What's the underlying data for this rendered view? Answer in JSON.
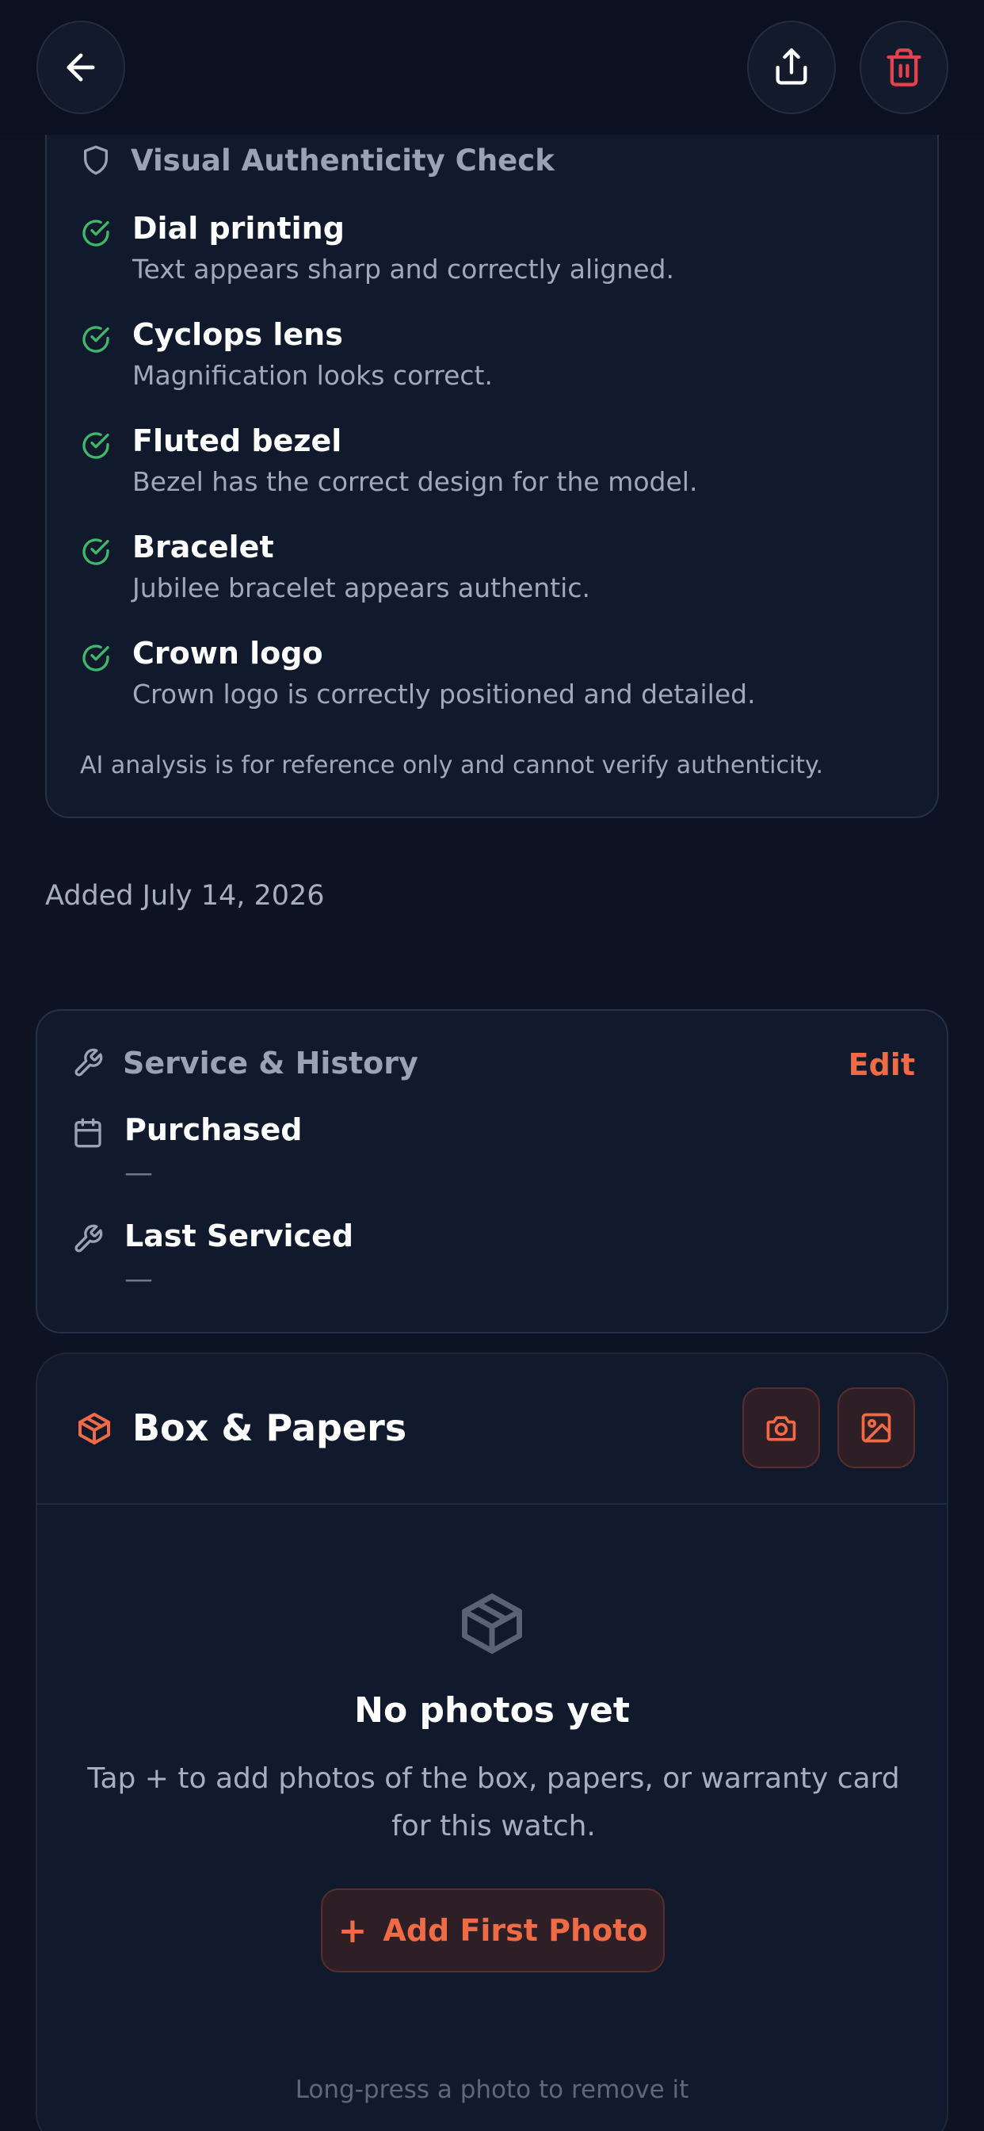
{
  "colors": {
    "background": "#0d1322",
    "card": "#111a2c",
    "accent": "#ef6a45",
    "success": "#3fb86a",
    "danger": "#e0424e",
    "muted_text": "#a0a9ba"
  },
  "topbar": {
    "back_icon": "arrow-left-icon",
    "share_icon": "share-icon",
    "delete_icon": "trash-icon"
  },
  "authenticity": {
    "title": "Visual Authenticity Check",
    "icon": "shield-icon",
    "items": [
      {
        "title": "Dial printing",
        "description": "Text appears sharp and correctly aligned.",
        "status": "pass"
      },
      {
        "title": "Cyclops lens",
        "description": "Magnification looks correct.",
        "status": "pass"
      },
      {
        "title": "Fluted bezel",
        "description": "Bezel has the correct design for the model.",
        "status": "pass"
      },
      {
        "title": "Bracelet",
        "description": "Jubilee bracelet appears authentic.",
        "status": "pass"
      },
      {
        "title": "Crown logo",
        "description": "Crown logo is correctly positioned and detailed.",
        "status": "pass"
      }
    ],
    "disclaimer": "AI analysis is for reference only and cannot verify authenticity."
  },
  "added_date": "Added July 14, 2026",
  "service": {
    "title": "Service & History",
    "edit_label": "Edit",
    "purchased_label": "Purchased",
    "purchased_value": "—",
    "last_serviced_label": "Last Serviced",
    "last_serviced_value": "—"
  },
  "box_papers": {
    "title": "Box & Papers",
    "empty_title": "No photos yet",
    "empty_description": "Tap + to add photos of the box, papers, or warranty card for this watch.",
    "add_button_plus": "+",
    "add_button_label": "Add First Photo",
    "hint": "Long-press a photo to remove it"
  }
}
